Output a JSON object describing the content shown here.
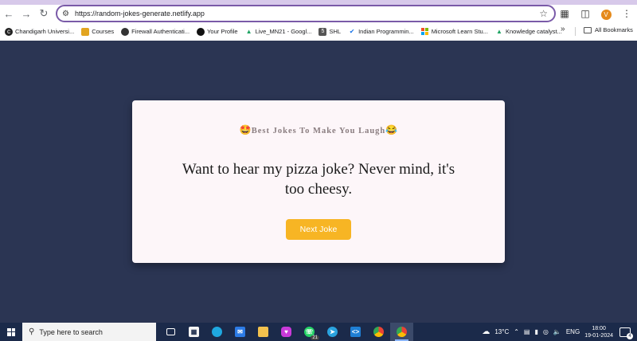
{
  "browser": {
    "url": "https://random-jokes-generate.netlify.app",
    "profile_initial": "V",
    "bookmarks": [
      {
        "label": "Chandigarh Universi...",
        "icon": "chandigarh-icon"
      },
      {
        "label": "Courses",
        "icon": "courses-icon"
      },
      {
        "label": "Firewall Authenticati...",
        "icon": "globe-icon"
      },
      {
        "label": "Your Profile",
        "icon": "github-icon"
      },
      {
        "label": "Live_MN21 - Googl...",
        "icon": "drive-icon"
      },
      {
        "label": "SHL",
        "icon": "shl-icon"
      },
      {
        "label": "Indian Programmin...",
        "icon": "ipa-icon"
      },
      {
        "label": "Microsoft Learn Stu...",
        "icon": "microsoft-icon"
      },
      {
        "label": "Knowledge catalyst...",
        "icon": "drive-icon"
      }
    ],
    "all_bookmarks_label": "All Bookmarks"
  },
  "card": {
    "title_emoji_left": "🤩",
    "title": "Best Jokes To Make You Laugh",
    "title_emoji_right": "😂",
    "joke": "Want to hear my pizza joke? Never mind, it's too cheesy.",
    "button_label": "Next Joke"
  },
  "taskbar": {
    "search_placeholder": "Type here to search",
    "whatsapp_badge": "21",
    "weather": "13°C",
    "language": "ENG",
    "time": "18:00",
    "date": "19-01-2024",
    "notification_count": "4"
  },
  "colors": {
    "page_background": "#2b3553",
    "card_background": "#fdf6f9",
    "button": "#f7b524",
    "omnibox_border": "#7a5aa8"
  }
}
